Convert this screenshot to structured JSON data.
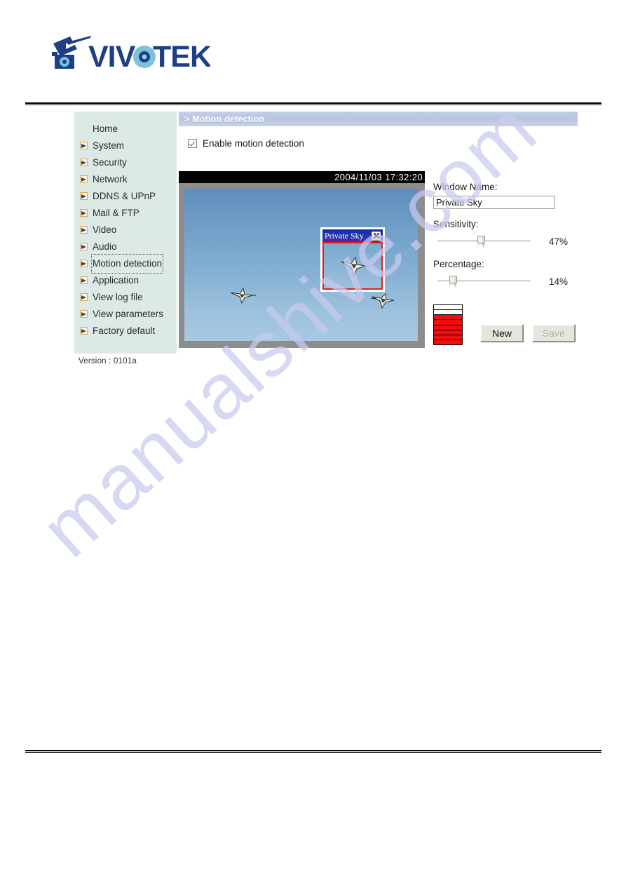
{
  "brand": {
    "logo_text": "VIVOTEK",
    "logo_icon": "vivotek-camera-logo"
  },
  "sidebar": {
    "items": [
      {
        "label": "Home",
        "icon": null,
        "selected": false
      },
      {
        "label": "System",
        "icon": "arrow-right-icon",
        "selected": false
      },
      {
        "label": "Security",
        "icon": "arrow-right-icon",
        "selected": false
      },
      {
        "label": "Network",
        "icon": "arrow-right-icon",
        "selected": false
      },
      {
        "label": "DDNS & UPnP",
        "icon": "arrow-right-icon",
        "selected": false
      },
      {
        "label": "Mail & FTP",
        "icon": "arrow-right-icon",
        "selected": false
      },
      {
        "label": "Video",
        "icon": "arrow-right-icon",
        "selected": false
      },
      {
        "label": "Audio",
        "icon": "arrow-right-icon",
        "selected": false
      },
      {
        "label": "Motion detection",
        "icon": "arrow-right-icon",
        "selected": true
      },
      {
        "label": "Application",
        "icon": "arrow-right-icon",
        "selected": false
      },
      {
        "label": "View log file",
        "icon": "arrow-right-icon",
        "selected": false
      },
      {
        "label": "View parameters",
        "icon": "arrow-right-icon",
        "selected": false
      },
      {
        "label": "Factory default",
        "icon": "arrow-right-icon",
        "selected": false
      }
    ],
    "version": "Version : 0101a"
  },
  "section": {
    "title": "> Motion detection"
  },
  "enable": {
    "label": "Enable motion detection",
    "checked": true,
    "checkbox_icon": "checkmark-icon"
  },
  "viewer": {
    "timestamp": "2004/11/03 17:32:20",
    "motion_window": {
      "title": "Private Sky",
      "close_icon": "close-x-icon",
      "border_color": "#e02020"
    }
  },
  "controls": {
    "window_name_label": "Window Name:",
    "window_name_value": "Private Sky",
    "window_name_placeholder": "Window Name",
    "sensitivity_label": "Sensitivity:",
    "sensitivity_value": "47%",
    "sensitivity_percent": 47,
    "percentage_label": "Percentage:",
    "percentage_value": "14%",
    "percentage_percent": 14,
    "meter": {
      "segments": 8,
      "filled": 6,
      "fill_color": "#f40b0b"
    },
    "new_button": "New",
    "save_button": "Save",
    "save_button_disabled": true
  },
  "watermark": {
    "text": "manualshive.com"
  }
}
